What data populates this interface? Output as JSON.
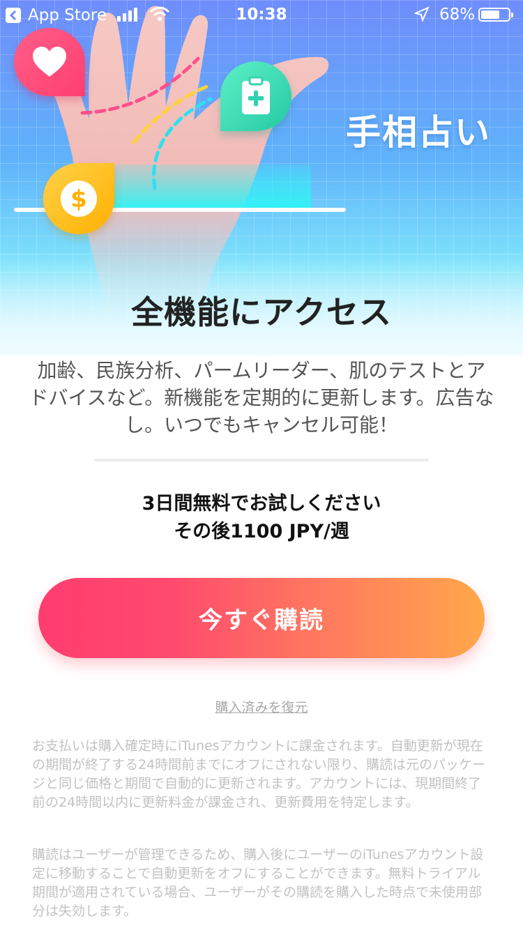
{
  "status_bar": {
    "back_app": "App Store",
    "time": "10:38",
    "battery": "68%",
    "battery_level": 0.68
  },
  "hero": {
    "title": "手相占い",
    "icons": [
      "heart-icon",
      "medical-clipboard-icon",
      "dollar-coin-icon"
    ]
  },
  "main": {
    "title": "全機能にアクセス",
    "description": "加齢、民族分析、パームリーダー、肌のテストとアドバイスなど。新機能を定期的に更新します。広告なし。いつでもキャンセル可能！",
    "trial_line1": "3日間無料でお試しください",
    "trial_line2": "その後1100 JPY/週",
    "subscribe_label": "今すぐ購読",
    "restore_label": "購入済みを復元"
  },
  "legal": {
    "paragraph1": "お支払いは購入確定時にiTunesアカウントに課金されます。自動更新が現在の期間が終了する24時間前までにオフにされない限り、購読は元のパッケージと同じ価格と期間で自動的に更新されます。アカウントには、現期間終了前の24時間以内に更新料金が課金され、更新費用を特定します。",
    "paragraph2": "購読はユーザーが管理できるため、購入後にユーザーのiTunesアカウント設定に移動することで自動更新をオフにすることができます。無料トライアル期間が適用されている場合、ユーザーがその購読を購入した時点で未使用部分は失効します。"
  },
  "colors": {
    "cta_start": "#ff3d6f",
    "cta_end": "#ffa84b",
    "hero_top": "#6f8dfb",
    "hero_bottom": "#7fe4fb"
  }
}
